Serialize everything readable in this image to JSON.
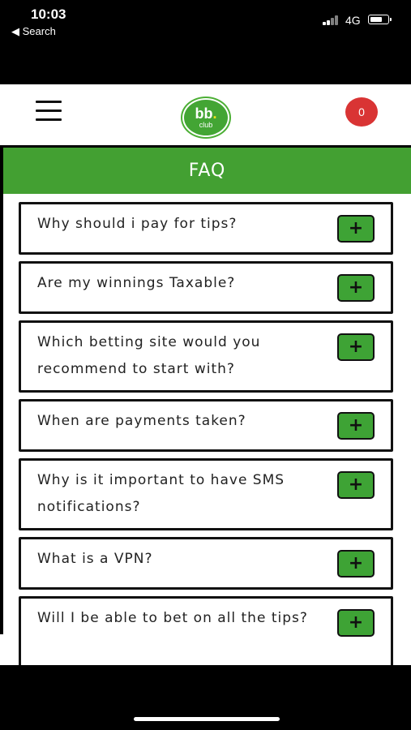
{
  "status_bar": {
    "time": "10:03",
    "back_label": "◀ Search",
    "network": "4G"
  },
  "header": {
    "logo_main": "bb",
    "logo_dot": ".",
    "logo_sub": "club",
    "cart_count": "0"
  },
  "banner": {
    "title": "FAQ"
  },
  "faq": {
    "items": [
      {
        "question": "Why should i pay for tips?",
        "button": "+"
      },
      {
        "question": "Are my winnings Taxable?",
        "button": "+"
      },
      {
        "question": "Which betting site would you recommend to start with?",
        "button": "+"
      },
      {
        "question": "When are payments taken?",
        "button": "+"
      },
      {
        "question": "Why is it important to have SMS notifications?",
        "button": "+"
      },
      {
        "question": "What is a VPN?",
        "button": "+"
      },
      {
        "question": "Will I be able to bet on all the tips?",
        "button": "+"
      }
    ]
  },
  "colors": {
    "brand_green": "#43a032",
    "badge_red": "#d93434",
    "logo_dot_yellow": "#f4e21b"
  }
}
